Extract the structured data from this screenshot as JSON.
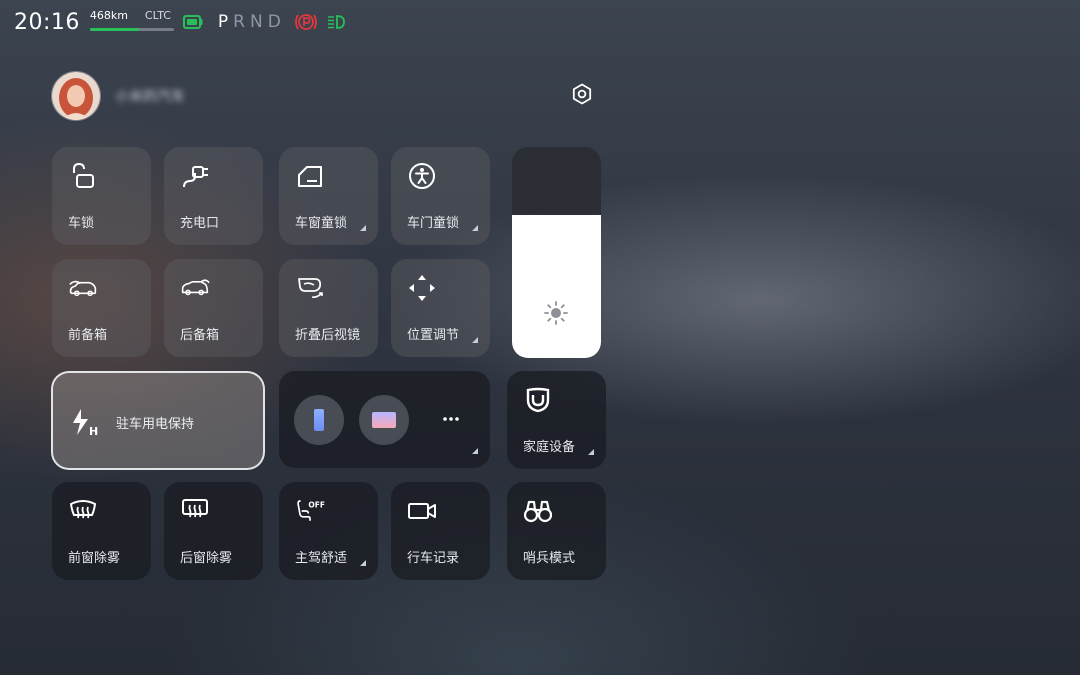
{
  "status": {
    "time": "20:16",
    "range_km": "468km",
    "range_standard": "CLTC",
    "battery_level": 0.58,
    "gears": [
      "P",
      "R",
      "N",
      "D"
    ],
    "active_gear": "P",
    "colors": {
      "battery": "#27c05a",
      "parking_brake": "#e2373f",
      "headlight": "#27c05a"
    }
  },
  "profile": {
    "name": "小米的汽车"
  },
  "tiles": {
    "car_lock": "车锁",
    "charge_port": "充电口",
    "window_child_lock": "车窗童锁",
    "door_child_lock": "车门童锁",
    "front_trunk": "前备箱",
    "rear_trunk": "后备箱",
    "fold_mirrors": "折叠后视镜",
    "position_adjust": "位置调节",
    "park_power_hold": "驻车用电保持",
    "home_devices": "家庭设备",
    "front_defrost": "前窗除雾",
    "rear_defrost": "后窗除雾",
    "driver_comfort": "主驾舒适",
    "dashcam": "行车记录",
    "sentry_mode": "哨兵模式"
  },
  "brightness": {
    "level": 0.68
  },
  "icons": {
    "settings": "gear-icon",
    "car_lock": "unlock-icon",
    "charge_port": "plug-icon",
    "window_child_lock": "window-icon",
    "door_child_lock": "child-icon",
    "front_trunk": "car-front-icon",
    "rear_trunk": "car-rear-icon",
    "fold_mirrors": "mirror-icon",
    "position_adjust": "move-arrows-icon",
    "park_power_hold": "power-hold-icon",
    "home_devices": "mi-home-icon",
    "front_defrost": "front-defrost-icon",
    "rear_defrost": "rear-defrost-icon",
    "driver_comfort": "seat-off-icon",
    "dashcam": "video-camera-icon",
    "sentry_mode": "binoculars-icon",
    "brightness": "sun-icon"
  }
}
